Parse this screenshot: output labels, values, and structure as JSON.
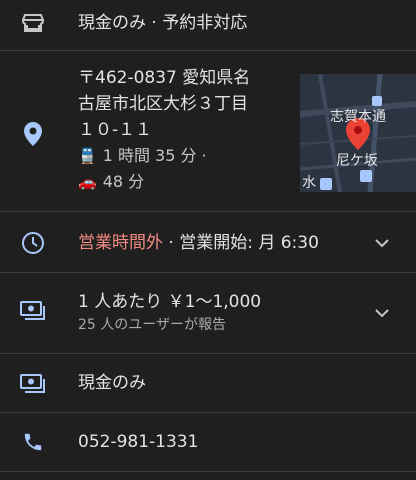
{
  "payment_policy": {
    "icon": "storefront-icon",
    "text": "現金のみ · 予約非対応"
  },
  "address": {
    "icon": "location-pin-icon",
    "lines": [
      "〒462-0837 愛知県名",
      "古屋市北区大杉３丁目",
      "１０-１１"
    ],
    "transit_icon": "train-icon",
    "transit_time": "1 時間 35 分 ·",
    "drive_icon": "car-icon",
    "drive_time": "48 分",
    "map": {
      "label_top": "志賀本通",
      "label_mid": "尼ケ坂",
      "label_left": "水"
    }
  },
  "hours": {
    "icon": "clock-icon",
    "status": "営業時間外",
    "detail": " · 営業開始: 月 6:30",
    "status_color": "#f28b82"
  },
  "price": {
    "icon": "money-icon",
    "text": "1 人あたり ￥1〜1,000",
    "sub": "25 人のユーザーが報告"
  },
  "payment": {
    "icon": "money-icon",
    "text": "現金のみ"
  },
  "phone": {
    "icon": "phone-icon",
    "text": "052-981-1331"
  },
  "accent_color": "#a8c7fa"
}
